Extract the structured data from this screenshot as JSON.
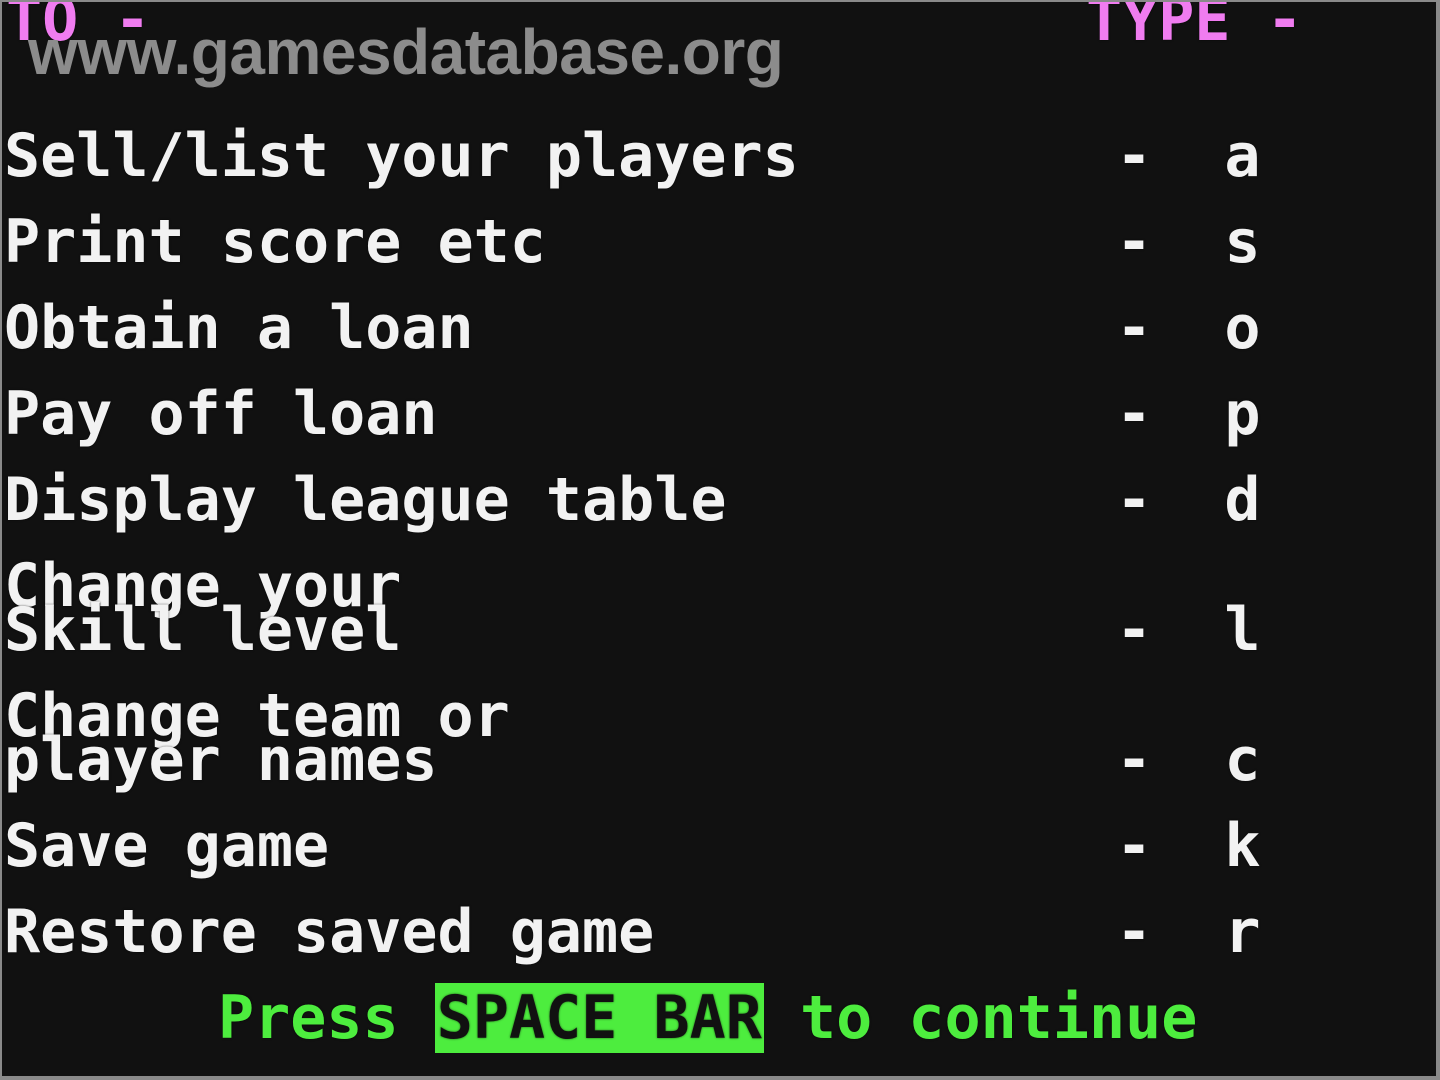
{
  "header": {
    "to_label": "TO -",
    "type_label": "TYPE -",
    "header_color": "#f07cf0"
  },
  "watermark": "www.gamesdatabase.org",
  "menu": [
    {
      "label_lines": [
        "Sell/list your players"
      ],
      "separator": "-",
      "key": "a"
    },
    {
      "label_lines": [
        "Print score etc"
      ],
      "separator": "-",
      "key": "s"
    },
    {
      "label_lines": [
        "Obtain a loan"
      ],
      "separator": "-",
      "key": "o"
    },
    {
      "label_lines": [
        "Pay off loan"
      ],
      "separator": "-",
      "key": "p"
    },
    {
      "label_lines": [
        "Display league table"
      ],
      "separator": "-",
      "key": "d"
    },
    {
      "label_lines": [
        "Change your",
        "Skill level"
      ],
      "separator": "-",
      "key": "l"
    },
    {
      "label_lines": [
        "Change team or",
        "player names"
      ],
      "separator": "-",
      "key": "c"
    },
    {
      "label_lines": [
        "Save game"
      ],
      "separator": "-",
      "key": "k"
    },
    {
      "label_lines": [
        "Restore saved game"
      ],
      "separator": "-",
      "key": "r"
    }
  ],
  "footer": {
    "prefix": "Press ",
    "highlight": "SPACE BAR",
    "suffix": " to continue",
    "color": "#4ded3e"
  }
}
